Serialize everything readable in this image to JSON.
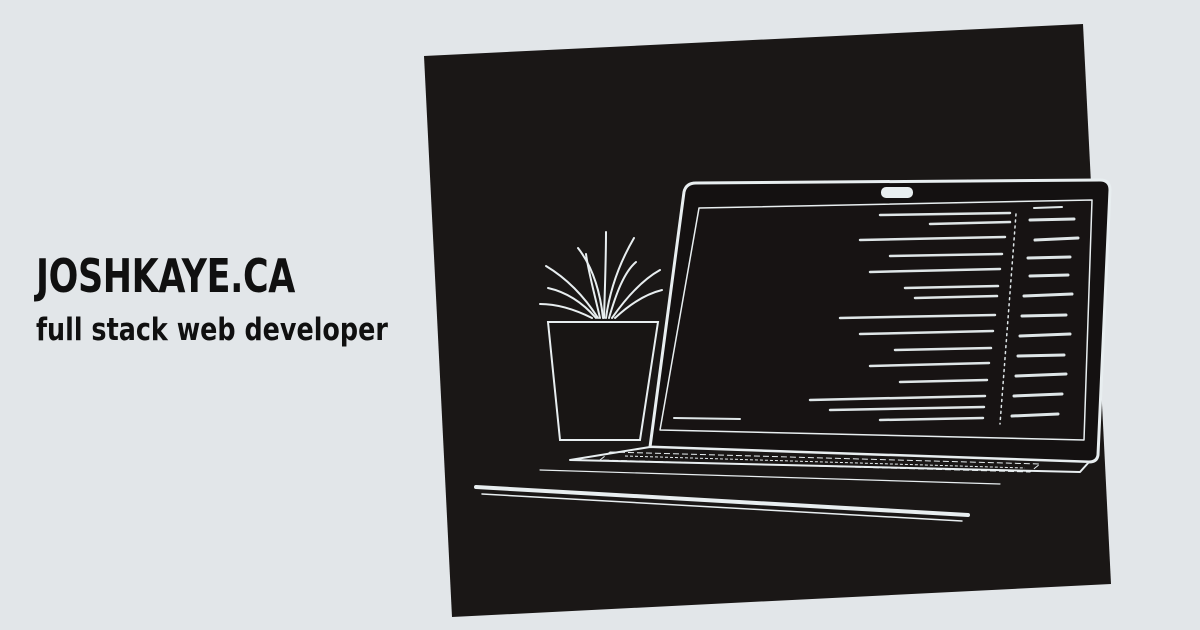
{
  "hero": {
    "site_name": "JOSHKAYE.CA",
    "tagline": "full stack web developer"
  },
  "colors": {
    "background": "#e2e6e9",
    "text": "#101010",
    "photo_background": "#1a1716",
    "line_art": "#e8eef0"
  },
  "image": {
    "subject_icons": [
      "laptop-icon",
      "potted-plant-icon"
    ]
  }
}
